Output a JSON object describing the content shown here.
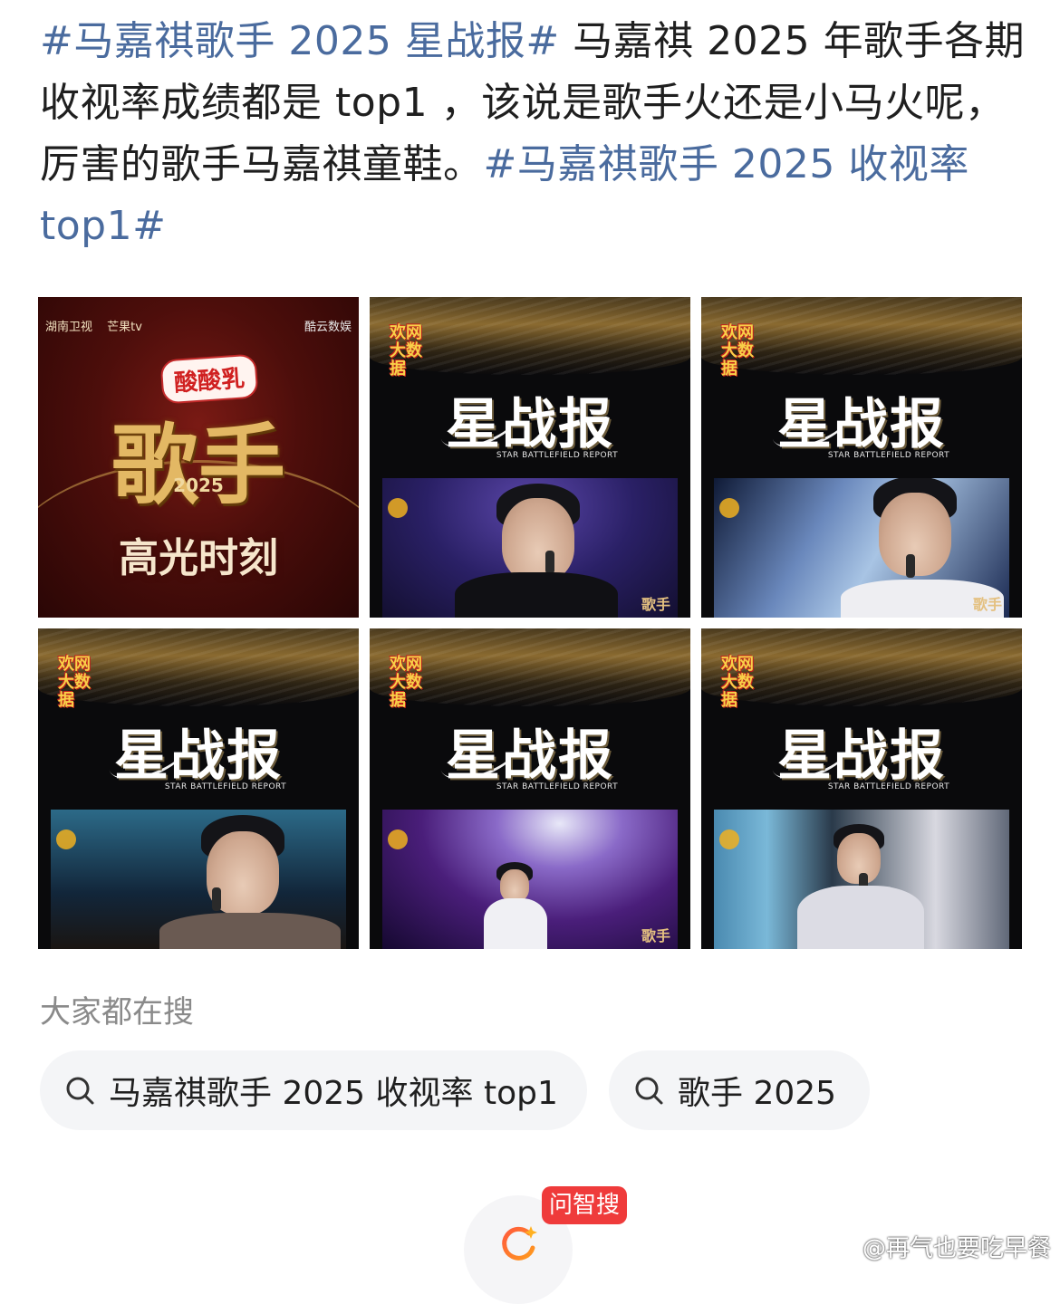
{
  "post": {
    "tag1": "#马嘉祺歌手 2025 星战报#",
    "body": " 马嘉祺 2025 年歌手各期收视率成绩都是 top1 ，该说是歌手火还是小马火呢，厉害的歌手马嘉祺童鞋。",
    "tag2": "#马嘉祺歌手 2025 收视率 top1#"
  },
  "images": {
    "poster": {
      "logo_left": "湖南卫视",
      "logo_mid": "芒果tv",
      "logo_right": "酷云数娱",
      "sponsor": "酸酸乳",
      "show_title": "歌手",
      "year": "2025",
      "caption": "高光时刻"
    },
    "report": {
      "badge": "欢网大数据",
      "title": "星战报",
      "subtitle": "STAR BATTLEFIELD REPORT",
      "stage_mark": "歌手"
    }
  },
  "search_section": {
    "label": "大家都在搜",
    "pills": [
      {
        "text": "马嘉祺歌手 2025 收视率 top1",
        "icon": "search-icon"
      },
      {
        "text": "歌手 2025",
        "icon": "search-icon"
      }
    ]
  },
  "fab": {
    "badge": "问智搜",
    "icon": "ai-search-icon"
  },
  "watermark": "@再气也要吃早餐",
  "colors": {
    "tag": "#4a6b9e",
    "badge_bg": "#ef3b3b",
    "pill_bg": "#f4f5f7",
    "label": "#8a8a8a"
  }
}
